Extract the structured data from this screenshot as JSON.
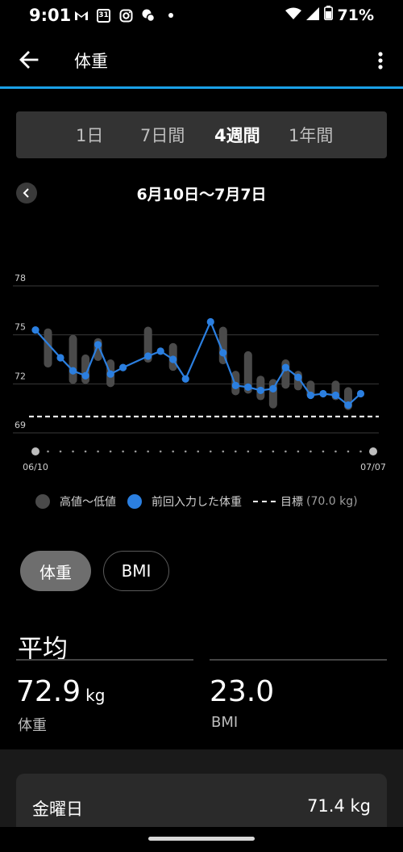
{
  "status_bar": {
    "time": "9:01",
    "battery_percent": "71%",
    "calendar_day": "31",
    "icons": [
      "gmail-icon",
      "calendar-icon",
      "instagram-icon",
      "chat-icon",
      "dot-icon",
      "wifi-icon",
      "signal-icon",
      "battery-icon"
    ]
  },
  "app_bar": {
    "title": "体重"
  },
  "period_tabs": {
    "items": [
      "1日",
      "7日間",
      "4週間",
      "1年間"
    ],
    "selected": "4週間"
  },
  "date_range": "6月10日〜7月7日",
  "chart_data": {
    "type": "line",
    "y_ticks": [
      "78",
      "75",
      "72",
      "69"
    ],
    "ylim": [
      69,
      78
    ],
    "x_start_label": "06/10",
    "x_end_label": "07/07",
    "x": [
      "06/10",
      "06/11",
      "06/12",
      "06/13",
      "06/14",
      "06/15",
      "06/16",
      "06/17",
      "06/18",
      "06/19",
      "06/20",
      "06/21",
      "06/22",
      "06/23",
      "06/24",
      "06/25",
      "06/26",
      "06/27",
      "06/28",
      "06/29",
      "06/30",
      "07/01",
      "07/02",
      "07/03",
      "07/04",
      "07/05",
      "07/06",
      "07/07"
    ],
    "series": [
      {
        "name": "前回入力した体重",
        "color": "#2b7fe0",
        "values": [
          75.3,
          null,
          73.6,
          72.8,
          72.5,
          74.4,
          72.6,
          73.0,
          null,
          73.7,
          74.0,
          73.5,
          72.3,
          null,
          75.8,
          73.9,
          71.9,
          71.8,
          71.6,
          71.7,
          73.0,
          72.4,
          71.3,
          71.4,
          71.3,
          70.7,
          71.4,
          null
        ]
      }
    ],
    "ranges": {
      "name": "高値〜低値",
      "color": "#4a4a4a",
      "low": [
        null,
        73.0,
        null,
        72.0,
        72.0,
        73.4,
        71.8,
        null,
        null,
        73.3,
        null,
        72.8,
        null,
        null,
        null,
        73.2,
        71.3,
        71.4,
        71.0,
        70.5,
        71.7,
        71.6,
        71.1,
        null,
        71.0,
        70.4,
        null,
        null
      ],
      "high": [
        null,
        75.4,
        null,
        75.0,
        73.8,
        74.8,
        73.5,
        null,
        null,
        75.5,
        null,
        74.5,
        null,
        null,
        null,
        75.5,
        72.8,
        74.0,
        72.5,
        72.3,
        73.5,
        72.8,
        72.2,
        null,
        72.2,
        71.8,
        null,
        null
      ]
    },
    "goal": 70.0,
    "goal_color": "#ffffff",
    "grid": true,
    "legend_position": "bottom"
  },
  "legend": {
    "range_label": "高値〜低値",
    "last_label": "前回入力した体重",
    "goal_label": "目標",
    "goal_value": "(70.0 kg)"
  },
  "toggle": {
    "weight_label": "体重",
    "bmi_label": "BMI"
  },
  "average": {
    "title": "平均",
    "weight_value": "72.9",
    "weight_unit": "kg",
    "weight_label": "体重",
    "bmi_value": "23.0",
    "bmi_label": "BMI"
  },
  "card": {
    "day": "金曜日",
    "value": "71.4 kg"
  },
  "colors": {
    "accent": "#1aa0e6",
    "series_blue": "#2b7fe0",
    "tab_bg": "#333333",
    "chip_selected": "#6e6e6e"
  }
}
